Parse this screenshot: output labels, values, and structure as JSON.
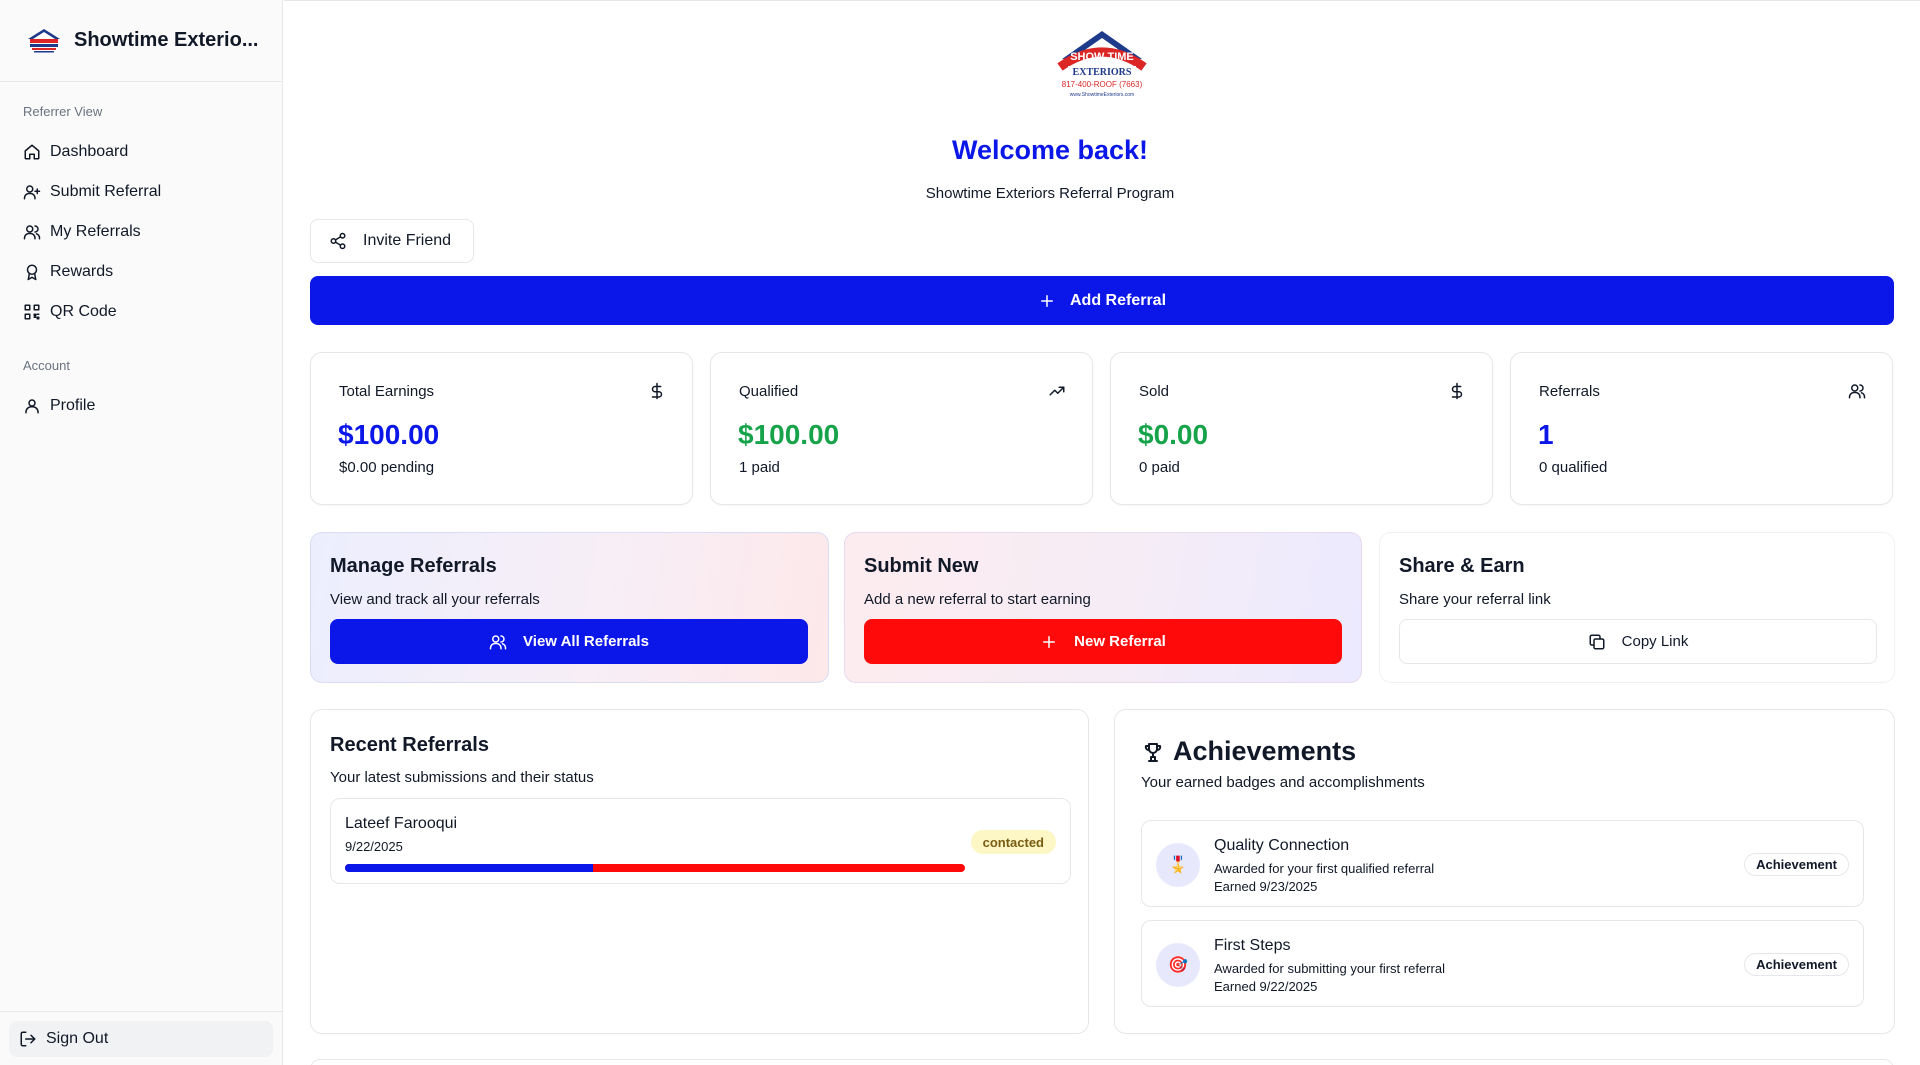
{
  "sidebar": {
    "brand": "Showtime Exterio...",
    "groups": [
      {
        "label": "Referrer View",
        "items": [
          {
            "label": "Dashboard",
            "icon": "home-icon"
          },
          {
            "label": "Submit Referral",
            "icon": "user-plus-icon"
          },
          {
            "label": "My Referrals",
            "icon": "users-icon"
          },
          {
            "label": "Rewards",
            "icon": "award-icon"
          },
          {
            "label": "QR Code",
            "icon": "qr-code-icon"
          }
        ]
      },
      {
        "label": "Account",
        "items": [
          {
            "label": "Profile",
            "icon": "user-icon"
          }
        ]
      }
    ],
    "sign_out": "Sign Out"
  },
  "header": {
    "welcome": "Welcome back!",
    "subtitle": "Showtime Exteriors Referral Program",
    "logo": {
      "line1": "SHOW TIME",
      "line2": "EXTERIORS",
      "phone": "817-400-ROOF (7663)",
      "web": "www.ShowtimeExteriors.com"
    }
  },
  "actions": {
    "invite_friend": "Invite Friend",
    "add_referral": "Add Referral"
  },
  "stats": [
    {
      "title": "Total Earnings",
      "value": "$100.00",
      "sub": "$0.00 pending",
      "icon": "dollar-icon",
      "color": "#0b16e8"
    },
    {
      "title": "Qualified",
      "value": "$100.00",
      "sub": "1 paid",
      "icon": "trending-up-icon",
      "color": "#16a34a"
    },
    {
      "title": "Sold",
      "value": "$0.00",
      "sub": "0 paid",
      "icon": "dollar-icon",
      "color": "#16a34a"
    },
    {
      "title": "Referrals",
      "value": "1",
      "sub": "0 qualified",
      "icon": "users-icon",
      "color": "#0b16e8"
    }
  ],
  "cards": {
    "manage": {
      "title": "Manage Referrals",
      "desc": "View and track all your referrals",
      "button": "View All Referrals"
    },
    "submit": {
      "title": "Submit New",
      "desc": "Add a new referral to start earning",
      "button": "New Referral"
    },
    "share": {
      "title": "Share & Earn",
      "desc": "Share your referral link",
      "button": "Copy Link"
    }
  },
  "recent": {
    "title": "Recent Referrals",
    "desc": "Your latest submissions and their status",
    "items": [
      {
        "name": "Lateef Farooqui",
        "date": "9/22/2025",
        "status": "contacted",
        "progress": 0.4
      }
    ]
  },
  "achievements": {
    "title": "Achievements",
    "desc": "Your earned badges and accomplishments",
    "items": [
      {
        "name": "Quality Connection",
        "desc": "Awarded for your first qualified referral",
        "earned": "Earned 9/23/2025",
        "badge": "Achievement",
        "emoji": "🎖️"
      },
      {
        "name": "First Steps",
        "desc": "Awarded for submitting your first referral",
        "earned": "Earned 9/22/2025",
        "badge": "Achievement",
        "emoji": "🎯"
      }
    ]
  },
  "colors": {
    "primary": "#0b16e8",
    "danger": "#ff0a0a",
    "success": "#16a34a",
    "status_badge_bg": "#fdf6c5"
  }
}
